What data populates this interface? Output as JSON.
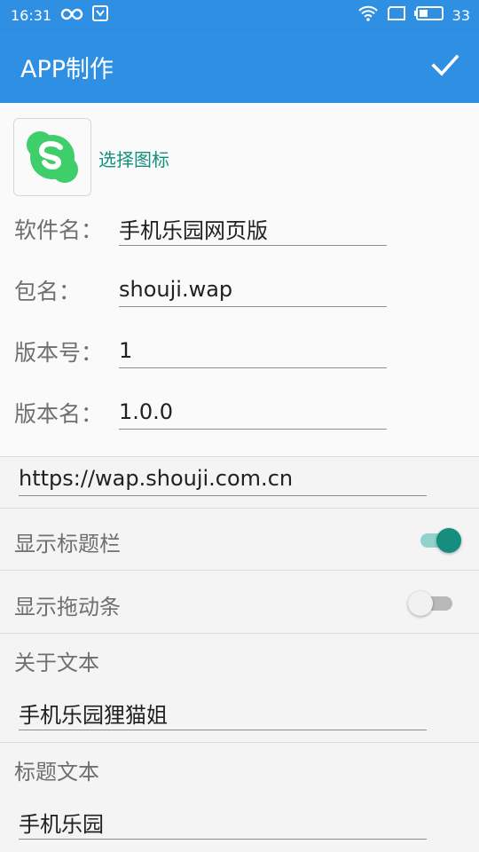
{
  "status_bar": {
    "time": "16:31",
    "battery": "33",
    "icons": [
      "infinity-icon",
      "download-icon",
      "wifi-icon",
      "screen-icon",
      "battery-icon"
    ]
  },
  "app_bar": {
    "title": "APP制作",
    "action_icon": "check-icon"
  },
  "icon_picker": {
    "icon": "skype-icon",
    "icon_color": "#3ecf6a",
    "select_label": "选择图标"
  },
  "fields": [
    {
      "label": "软件名：",
      "value": "手机乐园网页版"
    },
    {
      "label": "包名：",
      "value": "shouji.wap"
    },
    {
      "label": "版本号：",
      "value": "1"
    },
    {
      "label": "版本名：",
      "value": "1.0.0"
    }
  ],
  "url": {
    "value": "https://wap.shouji.com.cn"
  },
  "toggles": [
    {
      "label": "显示标题栏",
      "checked": true
    },
    {
      "label": "显示拖动条",
      "checked": false
    }
  ],
  "about": {
    "label": "关于文本",
    "value": "手机乐园狸猫姐"
  },
  "title_text": {
    "label": "标题文本",
    "value": "手机乐园"
  },
  "colors": {
    "primary": "#2f8fe3",
    "accent": "#158e80",
    "accent_light": "#8fd3cb"
  }
}
